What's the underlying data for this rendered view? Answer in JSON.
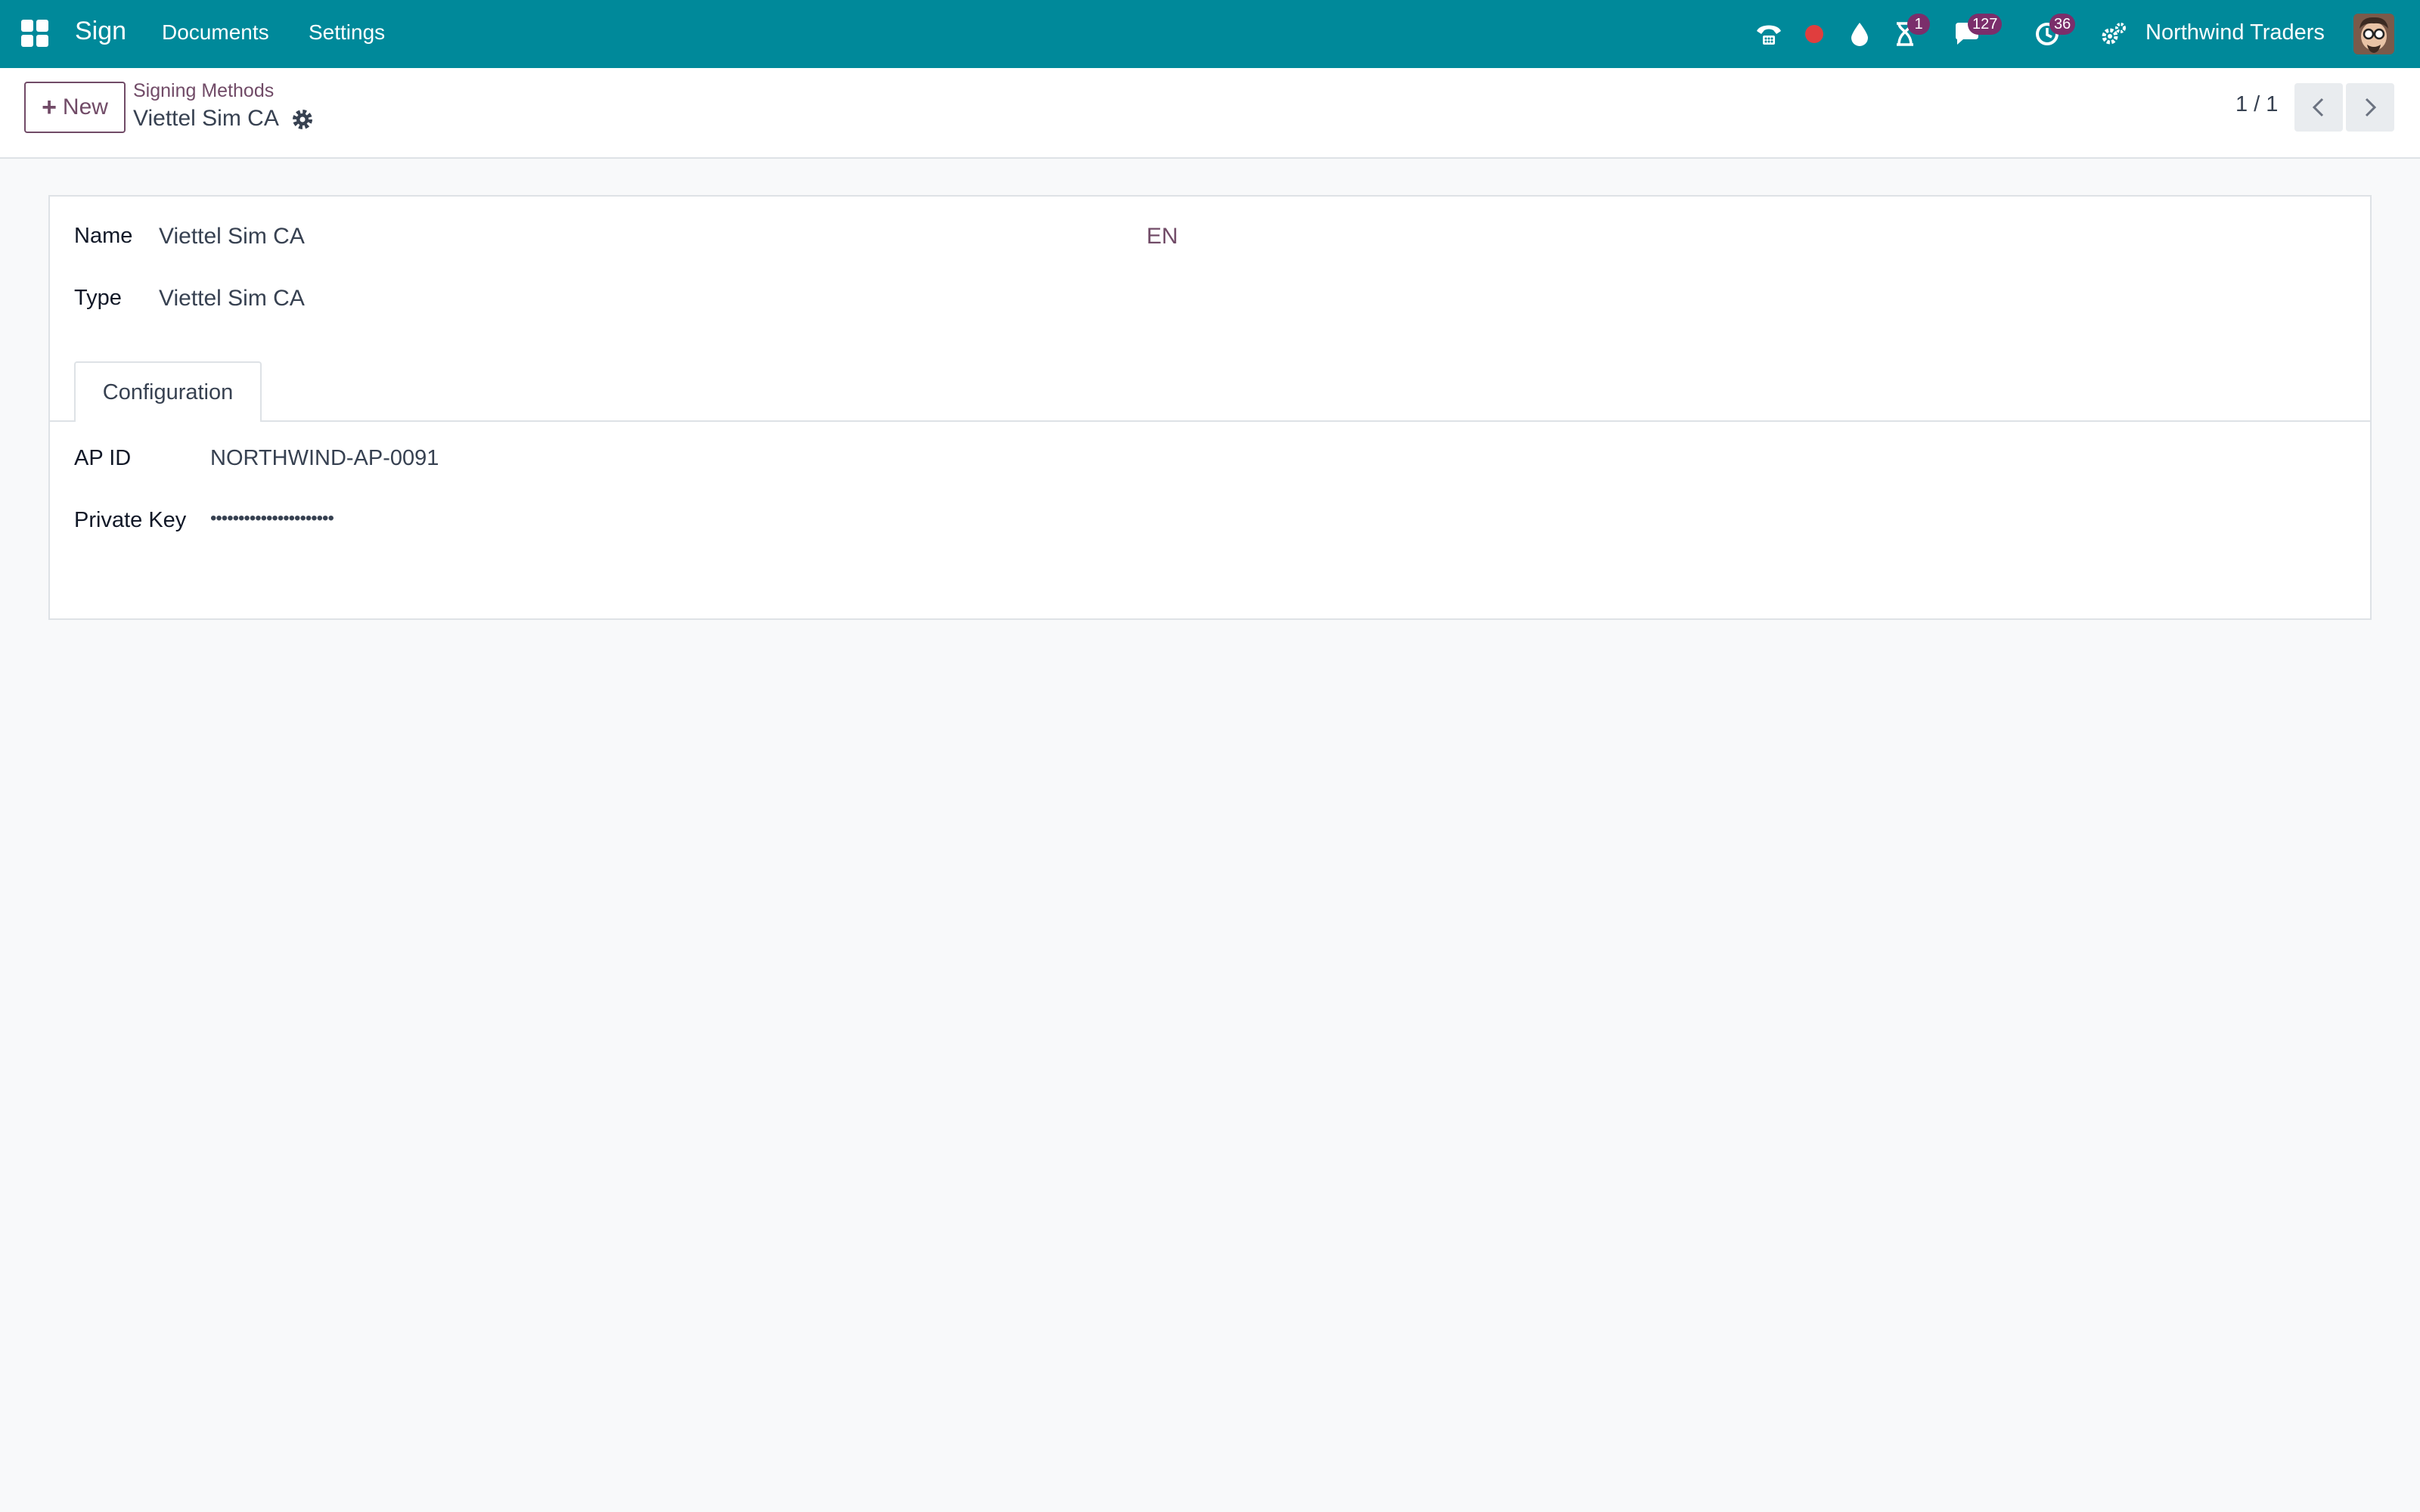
{
  "navbar": {
    "app_name": "Sign",
    "menu": [
      "Documents",
      "Settings"
    ],
    "badges": {
      "activities": "1",
      "messages": "127",
      "clock": "36"
    },
    "company": "Northwind Traders",
    "colors": {
      "bar": "#00899a",
      "badge": "#7b2e6b",
      "record_dot": "#e03e3e"
    }
  },
  "control_panel": {
    "new_label": "New",
    "breadcrumb_parent": "Signing Methods",
    "breadcrumb_current": "Viettel Sim CA",
    "pager": "1 / 1"
  },
  "form": {
    "name_label": "Name",
    "name_value": "Viettel Sim CA",
    "language": "EN",
    "type_label": "Type",
    "type_value": "Viettel Sim CA",
    "tabs": [
      "Configuration"
    ],
    "configuration": {
      "ap_id_label": "AP ID",
      "ap_id_value": "NORTHWIND-AP-0091",
      "private_key_label": "Private Key",
      "private_key_value": "••••••••••••••••••••••"
    }
  }
}
